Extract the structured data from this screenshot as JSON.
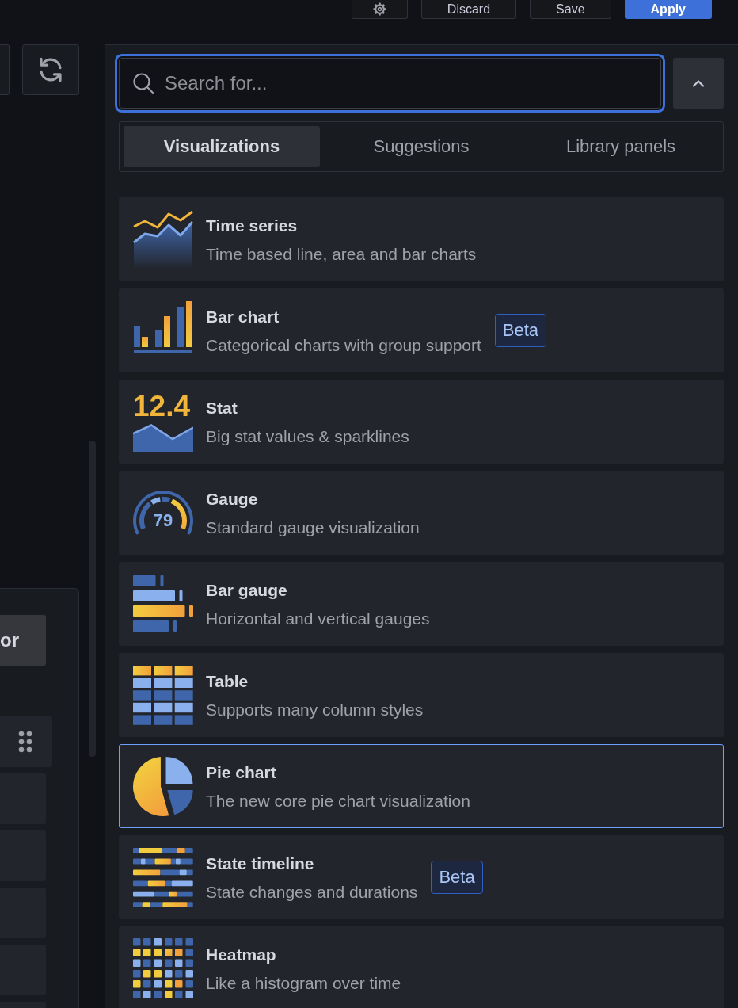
{
  "header_buttons": [
    {
      "kind": "settings"
    },
    {
      "kind": "secondary",
      "label": "Discard"
    },
    {
      "kind": "secondary",
      "label": "Save"
    },
    {
      "kind": "primary",
      "label": "Apply"
    }
  ],
  "left_pane": {
    "action_button": {
      "label": "or"
    }
  },
  "search": {
    "placeholder": "Search for...",
    "focused": true
  },
  "tabs": [
    {
      "label": "Visualizations",
      "selected": true
    },
    {
      "label": "Suggestions",
      "selected": false
    },
    {
      "label": "Library panels",
      "selected": false
    }
  ],
  "visualizations": [
    {
      "kind": "timeseries",
      "title": "Time series",
      "description": "Time based line, area and bar charts",
      "selected": false
    },
    {
      "kind": "barchart",
      "title": "Bar chart",
      "description": "Categorical charts with group support",
      "badge": "Beta",
      "selected": false
    },
    {
      "kind": "stat",
      "title": "Stat",
      "description": "Big stat values & sparklines",
      "icon_text": "12.4",
      "selected": false
    },
    {
      "kind": "gauge",
      "title": "Gauge",
      "description": "Standard gauge visualization",
      "icon_text": "79",
      "selected": false
    },
    {
      "kind": "bargauge",
      "title": "Bar gauge",
      "description": "Horizontal and vertical gauges",
      "selected": false
    },
    {
      "kind": "table",
      "title": "Table",
      "description": "Supports many column styles",
      "selected": false
    },
    {
      "kind": "piechart",
      "title": "Pie chart",
      "description": "The new core pie chart visualization",
      "selected": true
    },
    {
      "kind": "state-timeline",
      "title": "State timeline",
      "description": "State changes and durations",
      "badge": "Beta",
      "selected": false
    },
    {
      "kind": "heatmap",
      "title": "Heatmap",
      "description": "Like a histogram over time",
      "selected": false
    }
  ]
}
